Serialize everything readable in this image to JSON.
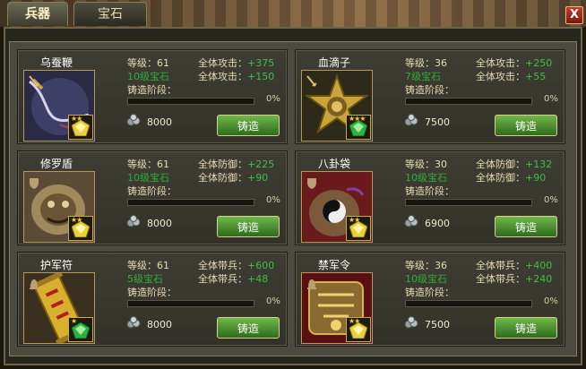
{
  "tabs": [
    {
      "label": "兵器",
      "active": true
    },
    {
      "label": "宝石",
      "active": false
    }
  ],
  "close_label": "X",
  "colors": {
    "accent_green": "#3fbf45",
    "button_green": "#4c9a30",
    "frame": "#6f6448"
  },
  "items": [
    {
      "name": "乌蚕鞭",
      "level": "等级：61",
      "gem": "10级宝石",
      "stat1_label": "全体攻击：",
      "stat1_value": "+375",
      "stat2_label": "全体攻击：",
      "stat2_value": "+150",
      "stage_label": "铸造阶段：",
      "progress": "0%",
      "cost": "8000",
      "button": "铸造",
      "icon": "whip-icon",
      "gem_icon": "yellow-gem-icon",
      "stars": "★★",
      "mini_icon": "sword-mini-icon",
      "art": "whip"
    },
    {
      "name": "血滴子",
      "level": "等级：36",
      "gem": "7级宝石",
      "stat1_label": "全体攻击：",
      "stat1_value": "+250",
      "stat2_label": "全体攻击：",
      "stat2_value": "+55",
      "stage_label": "铸造阶段：",
      "progress": "0%",
      "cost": "7500",
      "button": "铸造",
      "icon": "flying-guillotine-icon",
      "gem_icon": "green-gem-icon",
      "stars": "★★★",
      "mini_icon": "sword-mini-icon",
      "art": "star"
    },
    {
      "name": "修罗盾",
      "level": "等级：61",
      "gem": "10级宝石",
      "stat1_label": "全体防御：",
      "stat1_value": "+225",
      "stat2_label": "全体防御：",
      "stat2_value": "+90",
      "stage_label": "铸造阶段：",
      "progress": "0%",
      "cost": "8000",
      "button": "铸造",
      "icon": "shield-icon",
      "gem_icon": "yellow-gem-icon",
      "stars": "★★",
      "mini_icon": "shield-mini-icon",
      "art": "shield"
    },
    {
      "name": "八卦袋",
      "level": "等级：30",
      "gem": "10级宝石",
      "stat1_label": "全体防御：",
      "stat1_value": "+132",
      "stat2_label": "全体防御：",
      "stat2_value": "+90",
      "stage_label": "铸造阶段：",
      "progress": "0%",
      "cost": "6900",
      "button": "铸造",
      "icon": "bagua-bag-icon",
      "gem_icon": "yellow-gem-icon",
      "stars": "★★",
      "mini_icon": "shield-mini-icon",
      "art": "bag"
    },
    {
      "name": "护军符",
      "level": "等级：61",
      "gem": "5级宝石",
      "stat1_label": "全体带兵：",
      "stat1_value": "+600",
      "stat2_label": "全体带兵：",
      "stat2_value": "+48",
      "stage_label": "铸造阶段：",
      "progress": "0%",
      "cost": "8000",
      "button": "铸造",
      "icon": "talisman-icon",
      "gem_icon": "green-gem-icon",
      "stars": "★",
      "mini_icon": "helmet-mini-icon",
      "art": "scroll"
    },
    {
      "name": "禁军令",
      "level": "等级：36",
      "gem": "10级宝石",
      "stat1_label": "全体带兵：",
      "stat1_value": "+400",
      "stat2_label": "全体带兵：",
      "stat2_value": "+240",
      "stage_label": "铸造阶段：",
      "progress": "0%",
      "cost": "7500",
      "button": "铸造",
      "icon": "command-token-icon",
      "gem_icon": "yellow-gem-icon",
      "stars": "★★",
      "mini_icon": "helmet-mini-icon",
      "art": "token"
    }
  ]
}
